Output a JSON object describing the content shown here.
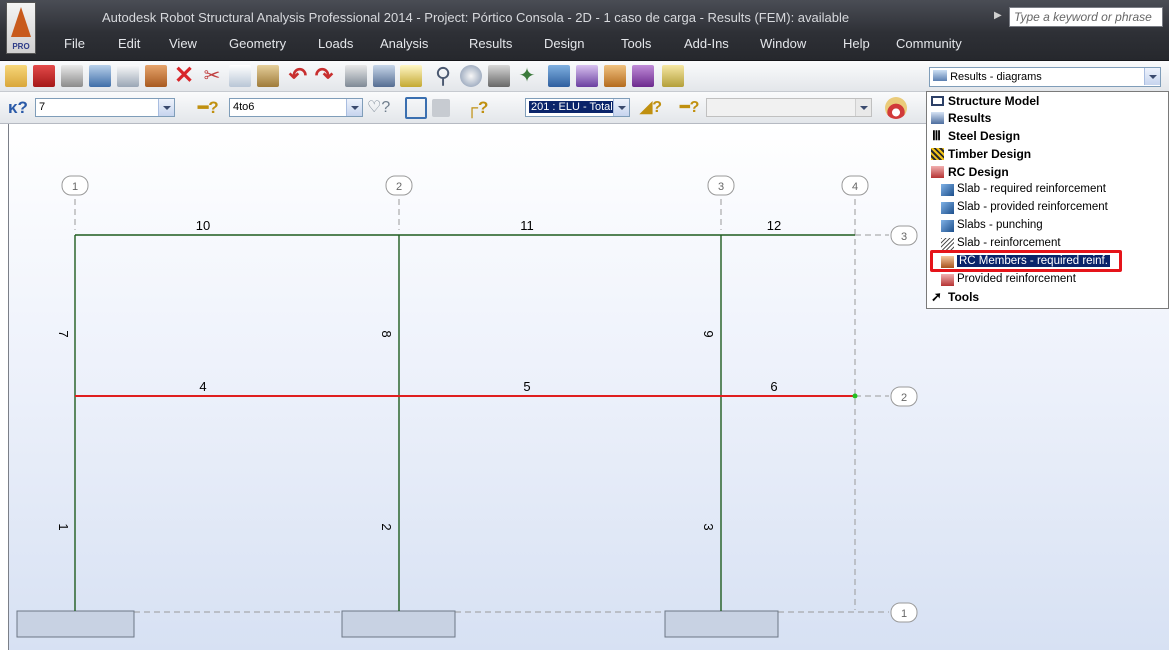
{
  "window": {
    "title": "Autodesk Robot Structural Analysis Professional 2014 - Project: Pórtico Consola - 2D - 1 caso de carga - Results (FEM): available",
    "search_placeholder": "Type a keyword or phrase",
    "logo_text": "PRO"
  },
  "menu": [
    "File",
    "Edit",
    "View",
    "Geometry",
    "Loads",
    "Analysis",
    "Results",
    "Design",
    "Tools",
    "Add-Ins",
    "Window",
    "Help",
    "Community"
  ],
  "toolbar1": {
    "layout_combo_value": "Results - diagrams"
  },
  "toolbar2": {
    "selection_value": "7",
    "section_value": "4to6",
    "case_value": "201 : ELU - Total"
  },
  "layout_menu": {
    "items": [
      {
        "label": "Structure Model",
        "level": "top",
        "icon": "structure-model-icon"
      },
      {
        "label": "Results",
        "level": "top",
        "icon": "results-icon"
      },
      {
        "label": "Steel Design",
        "level": "top",
        "icon": "steel-design-icon"
      },
      {
        "label": "Timber Design",
        "level": "top",
        "icon": "timber-design-icon"
      },
      {
        "label": "RC Design",
        "level": "top",
        "icon": "rc-design-icon"
      },
      {
        "label": "Slab - required reinforcement",
        "level": "sub",
        "icon": "slab-icon"
      },
      {
        "label": "Slab - provided reinforcement",
        "level": "sub",
        "icon": "slab-icon"
      },
      {
        "label": "Slabs - punching",
        "level": "sub",
        "icon": "slab-icon"
      },
      {
        "label": "Slab - reinforcement",
        "level": "sub",
        "icon": "slab-reinforcement-icon"
      },
      {
        "label": "RC Members - required reinf.",
        "level": "sub",
        "icon": "rc-members-icon",
        "selected": true
      },
      {
        "label": "Provided reinforcement",
        "level": "sub",
        "icon": "provided-reinforcement-icon"
      },
      {
        "label": "Tools",
        "level": "top",
        "icon": "tools-icon"
      }
    ]
  },
  "model": {
    "axes_vertical": [
      "1",
      "2",
      "3",
      "4"
    ],
    "axes_horizontal": [
      "3",
      "2",
      "1"
    ],
    "beam_labels": [
      "10",
      "11",
      "12",
      "4",
      "5",
      "6"
    ],
    "column_labels": [
      "7",
      "8",
      "9",
      "1",
      "2",
      "3"
    ],
    "colors": {
      "beam": "#1f5c1f",
      "selected_beam": "#e01e1e",
      "grid": "#9a9a9a",
      "support": "#c8d2e3"
    }
  }
}
